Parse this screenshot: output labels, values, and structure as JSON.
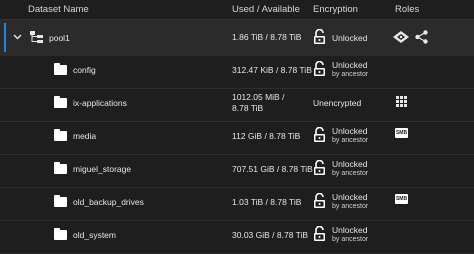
{
  "header": {
    "dataset_name": "Dataset Name",
    "used_available": "Used / Available",
    "encryption": "Encryption",
    "roles": "Roles"
  },
  "rows": [
    {
      "name": "pool1",
      "used": "1.86 TiB / 8.78 TiB",
      "enc": "Unlocked",
      "enc_sub": "",
      "role_icons": [
        "vm-icon",
        "share-icon"
      ]
    },
    {
      "name": "config",
      "used": "312.47 KiB / 8.78 TiB",
      "enc": "Unlocked",
      "enc_sub": "by ancestor",
      "role_icons": []
    },
    {
      "name": "ix-applications",
      "used_line1": "1012.05 MiB /",
      "used_line2": "8.78 TiB",
      "enc": "Unencrypted",
      "enc_sub": "",
      "role_icons": [
        "apps-grid-icon"
      ]
    },
    {
      "name": "media",
      "used": "112 GiB / 8.78 TiB",
      "enc": "Unlocked",
      "enc_sub": "by ancestor",
      "role_icons": [
        "smb-share-icon"
      ]
    },
    {
      "name": "miguel_storage",
      "used": "707.51 GiB / 8.78 TiB",
      "enc": "Unlocked",
      "enc_sub": "by ancestor",
      "role_icons": []
    },
    {
      "name": "old_backup_drives",
      "used": "1.03 TiB / 8.78 TiB",
      "enc": "Unlocked",
      "enc_sub": "by ancestor",
      "role_icons": [
        "smb-share-icon"
      ]
    },
    {
      "name": "old_system",
      "used": "30.03 GiB / 8.78 TiB",
      "enc": "Unlocked",
      "enc_sub": "by ancestor",
      "role_icons": []
    }
  ],
  "smb_label": "SMB",
  "colors": {
    "accent": "#1e88e5",
    "background": "#1e1e1e",
    "selected_row": "#2b2b2b"
  }
}
